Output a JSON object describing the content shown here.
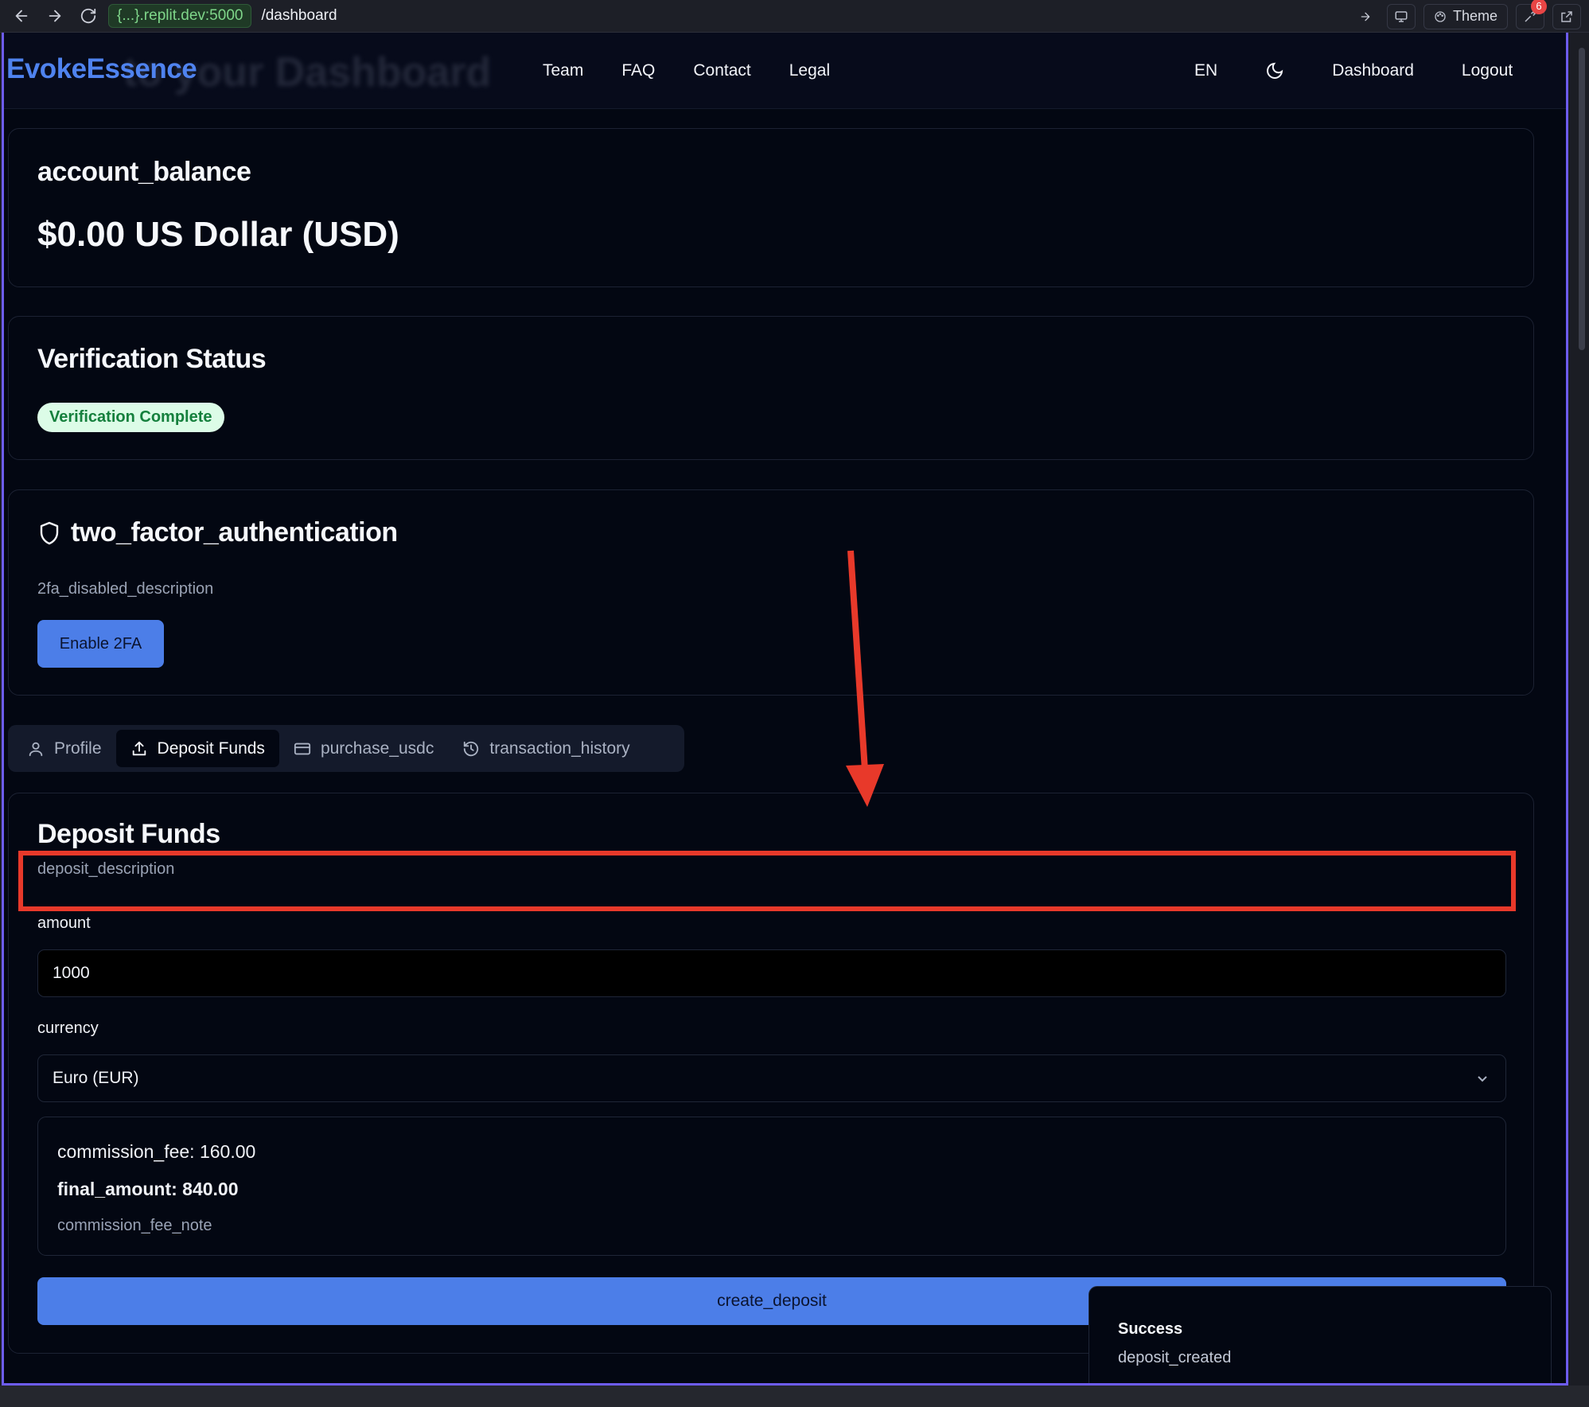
{
  "browser": {
    "url_host": "{...}.replit.dev:5000",
    "url_path": "/dashboard",
    "theme_label": "Theme",
    "notification_count": "6"
  },
  "header": {
    "logo": "EvokeEssence",
    "ghost_title": "to your Dashboard",
    "nav": [
      "Team",
      "FAQ",
      "Contact",
      "Legal"
    ],
    "language": "EN",
    "dashboard_label": "Dashboard",
    "logout_label": "Logout"
  },
  "balance_card": {
    "title": "account_balance",
    "value": "$0.00 US Dollar (USD)"
  },
  "verification_card": {
    "title": "Verification Status",
    "badge": "Verification Complete",
    "badge_color": "#15803d"
  },
  "twofa_card": {
    "icon": "shield-icon",
    "title": "two_factor_authentication",
    "description": "2fa_disabled_description",
    "button_label": "Enable 2FA"
  },
  "tabs": [
    {
      "label": "Profile",
      "icon": "user-icon",
      "active": false
    },
    {
      "label": "Deposit Funds",
      "icon": "upload-icon",
      "active": true
    },
    {
      "label": "purchase_usdc",
      "icon": "credit-card-icon",
      "active": false
    },
    {
      "label": "transaction_history",
      "icon": "history-icon",
      "active": false
    }
  ],
  "deposit": {
    "title": "Deposit Funds",
    "description": "deposit_description",
    "amount_label": "amount",
    "amount_value": "1000",
    "currency_label": "currency",
    "currency_value": "Euro (EUR)",
    "commission_fee": "commission_fee: 160.00",
    "final_amount": "final_amount: 840.00",
    "fee_note": "commission_fee_note",
    "submit_label": "create_deposit"
  },
  "toast": {
    "title": "Success",
    "description": "deposit_created"
  },
  "colors": {
    "accent": "#4c7ee8",
    "annotation": "#e8392a",
    "frame": "#6d5cf0",
    "background": "#030712"
  }
}
